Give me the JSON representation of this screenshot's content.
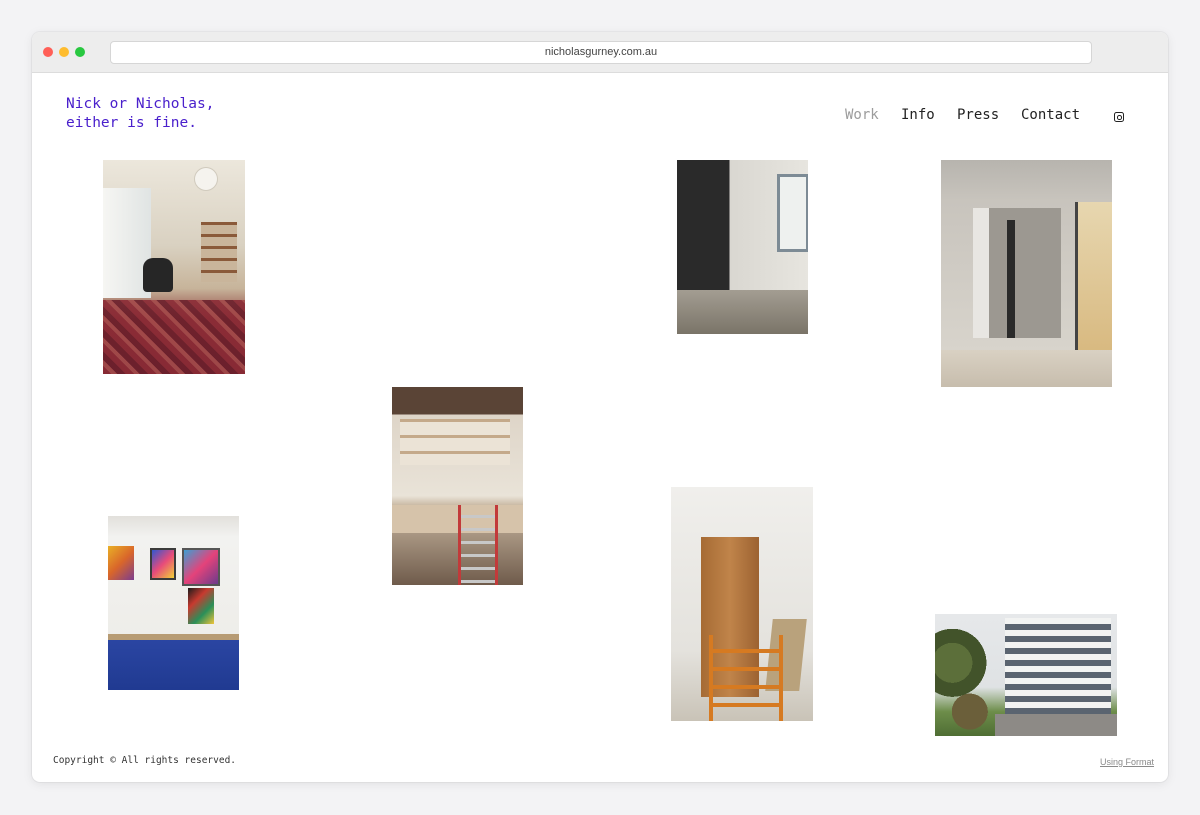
{
  "browser": {
    "url": "nicholasgurney.com.au"
  },
  "site": {
    "logo_line1": "Nick or Nicholas,",
    "logo_line2": "either is fine."
  },
  "nav": {
    "items": [
      {
        "label": "Work",
        "active": true
      },
      {
        "label": "Info",
        "active": false
      },
      {
        "label": "Press",
        "active": false
      },
      {
        "label": "Contact",
        "active": false
      }
    ],
    "social_icon": "instagram-icon"
  },
  "gallery": {
    "photos": [
      {
        "subject": "living-room"
      },
      {
        "subject": "bathroom"
      },
      {
        "subject": "stone-niche"
      },
      {
        "subject": "kitchen-ladder"
      },
      {
        "subject": "blue-sideboard"
      },
      {
        "subject": "wardrobe-ladder"
      },
      {
        "subject": "white-building"
      }
    ]
  },
  "footer": {
    "copyright": "Copyright © All rights reserved.",
    "format_link": "Using Format"
  },
  "colors": {
    "logo": "#4a20cc",
    "nav_active": "#9c9c9c",
    "nav_text": "#222222"
  }
}
